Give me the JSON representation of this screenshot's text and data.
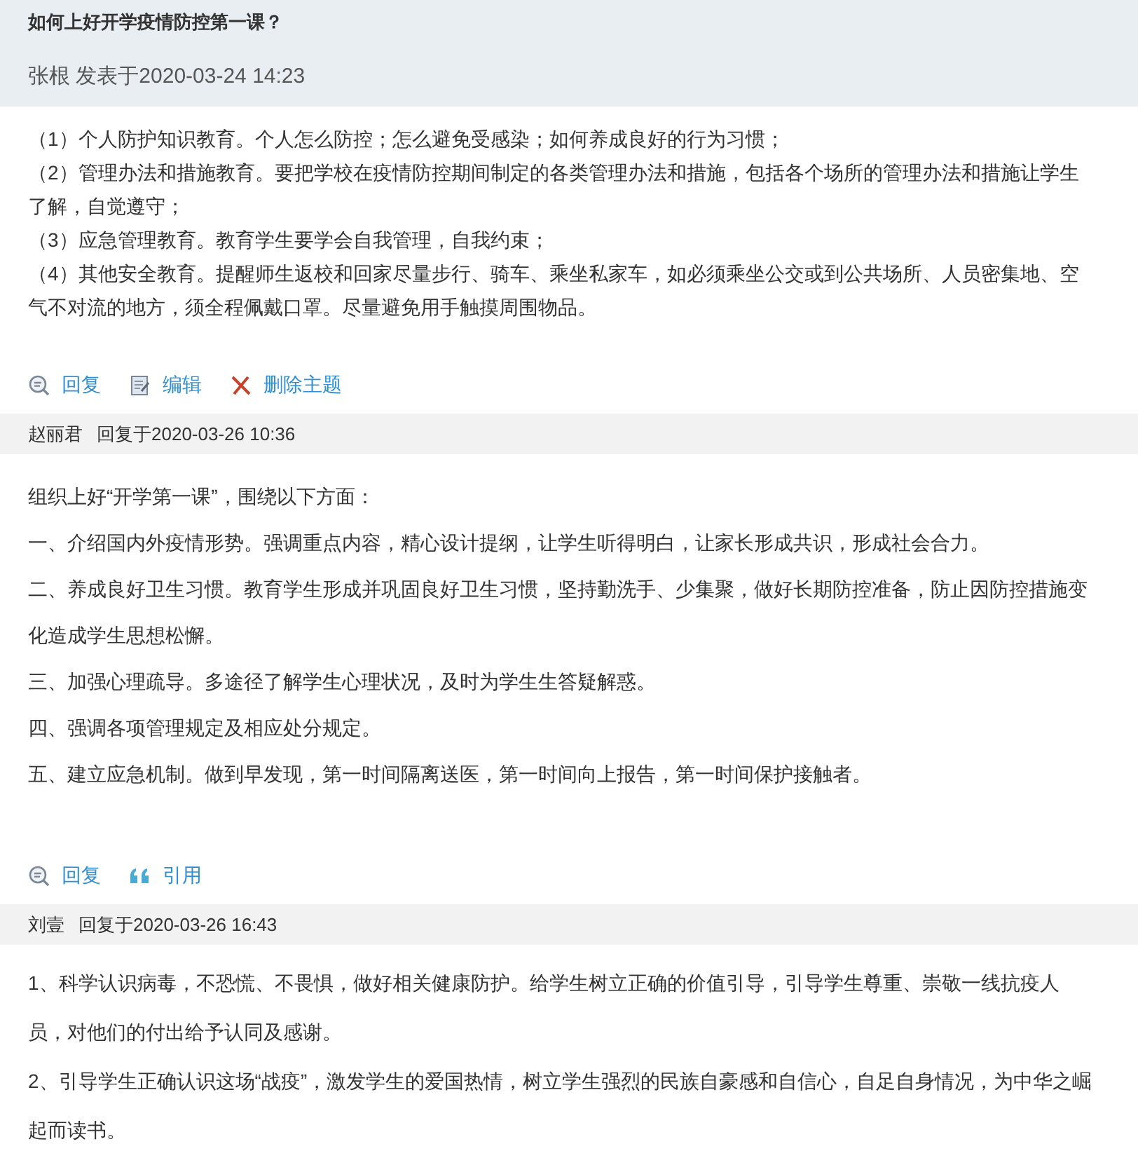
{
  "topic": {
    "title": "如何上好开学疫情防控第一课？",
    "byline": "张根 发表于2020-03-24 14:23",
    "paragraphs": [
      "（1）个人防护知识教育。个人怎么防控；怎么避免受感染；如何养成良好的行为习惯；",
      "（2）管理办法和措施教育。要把学校在疫情防控期间制定的各类管理办法和措施，包括各个场所的管理办法和措施让学生了解，自觉遵守；",
      "（3）应急管理教育。教育学生要学会自我管理，自我约束；",
      "（4）其他安全教育。提醒师生返校和回家尽量步行、骑车、乘坐私家车，如必须乘坐公交或到公共场所、人员密集地、空气不对流的地方，须全程佩戴口罩。尽量避免用手触摸周围物品。"
    ],
    "actions": [
      {
        "kind": "reply",
        "label": "回复"
      },
      {
        "kind": "edit",
        "label": "编辑"
      },
      {
        "kind": "delete",
        "label": "删除主题"
      }
    ]
  },
  "replies": [
    {
      "author": "赵丽君",
      "posted": "回复于2020-03-26 10:36",
      "paragraphs": [
        "组织上好“开学第一课”，围绕以下方面：",
        "一、介绍国内外疫情形势。强调重点内容，精心设计提纲，让学生听得明白，让家长形成共识，形成社会合力。",
        "二、养成良好卫生习惯。教育学生形成并巩固良好卫生习惯，坚持勤洗手、少集聚，做好长期防控准备，防止因防控措施变化造成学生思想松懈。",
        "三、加强心理疏导。多途径了解学生心理状况，及时为学生生答疑解惑。",
        "四、强调各项管理规定及相应处分规定。",
        "五、建立应急机制。做到早发现，第一时间隔离送医，第一时间向上报告，第一时间保护接触者。"
      ],
      "actions": [
        {
          "kind": "reply",
          "label": "回复"
        },
        {
          "kind": "quote",
          "label": "引用"
        }
      ]
    },
    {
      "author": "刘壹",
      "posted": "回复于2020-03-26 16:43",
      "paragraphs": [
        "1、科学认识病毒，不恐慌、不畏惧，做好相关健康防护。给学生树立正确的价值引导，引导学生尊重、崇敬一线抗疫人员，对他们的付出给予认同及感谢。",
        "2、引导学生正确认识这场“战疫”，激发学生的爱国热情，树立学生强烈的民族自豪感和自信心，自足自身情况，为中华之崛起而读书。"
      ]
    }
  ]
}
